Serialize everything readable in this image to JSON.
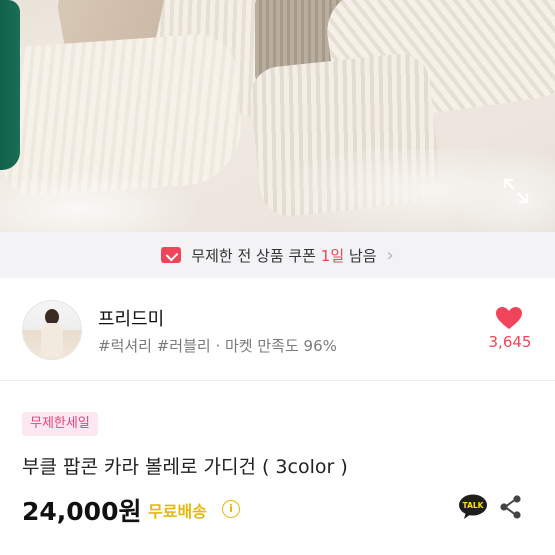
{
  "coupon_banner": {
    "prefix": "무제한 전 상품 쿠폰",
    "highlight": "1일",
    "suffix": "남음",
    "chevron": "›"
  },
  "seller": {
    "name": "프리드미",
    "tags": "#럭셔리 #러블리 · 마켓 만족도 96%",
    "likes": "3,645"
  },
  "product": {
    "badge": "무제한세일",
    "title": "부클 팝콘 카라 볼레로 가디건 ( 3color )",
    "price": "24,000원",
    "shipping": "무료배송",
    "info_icon": "i"
  },
  "icons": {
    "kakaotalk_label": "TALK"
  },
  "colors": {
    "accent": "#f0445a",
    "badge_bg": "#fde7f1",
    "badge_text": "#e0457a",
    "shipping": "#e5b90f"
  }
}
